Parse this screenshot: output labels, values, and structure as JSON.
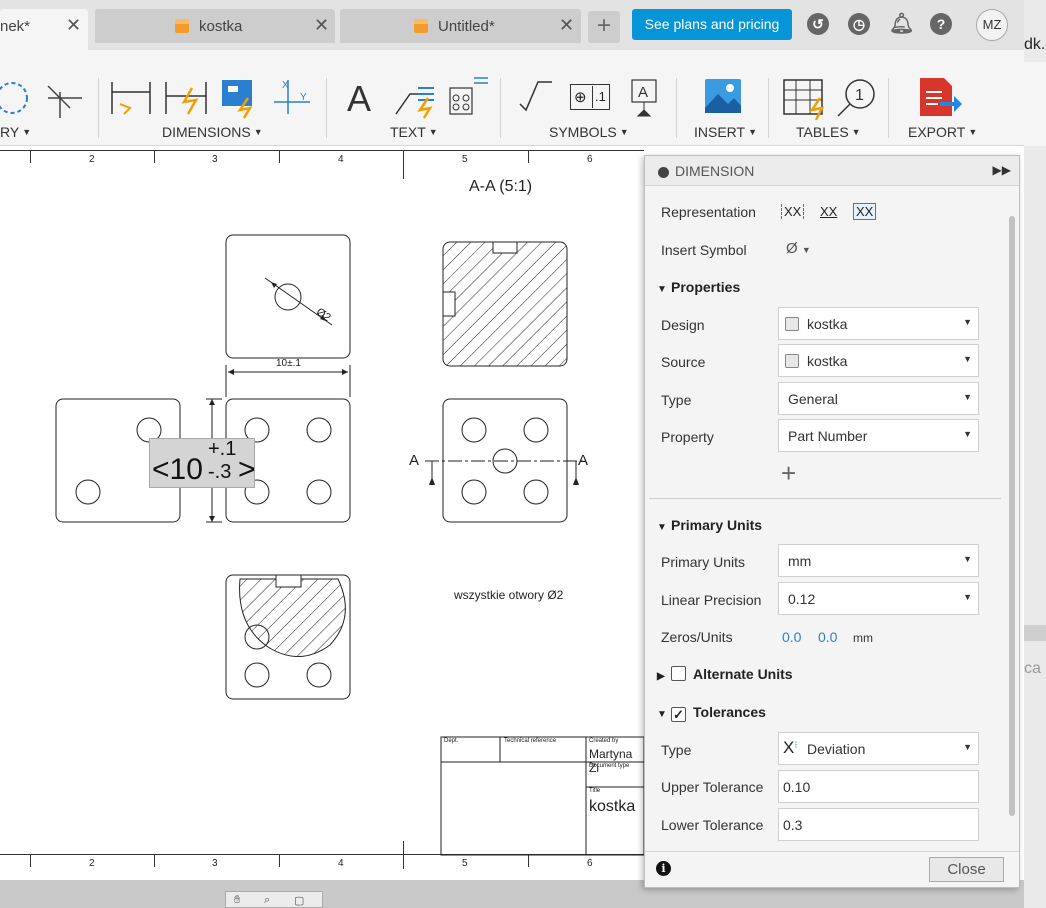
{
  "tabs": [
    {
      "label": "nek*",
      "active": true
    },
    {
      "label": "kostka",
      "active": false
    },
    {
      "label": "Untitled*",
      "active": false
    }
  ],
  "header": {
    "plans_button": "See plans and pricing",
    "avatar_initials": "MZ"
  },
  "ribbon": {
    "groups": [
      "RY",
      "DIMENSIONS",
      "TEXT",
      "SYMBOLS",
      "INSERT",
      "TABLES",
      "EXPORT"
    ],
    "text_glyph": "A",
    "symbol_text": ".1",
    "balloon_num": "1"
  },
  "drawing": {
    "ruler_numbers": [
      "2",
      "3",
      "4",
      "5",
      "6"
    ],
    "section_title": "A-A (5:1)",
    "dim_diameter": "Ø2",
    "dim_width": "10±.1",
    "dim_edit_main": "<10",
    "dim_edit_upper": "+.1",
    "dim_edit_lower": "-.3",
    "dim_edit_close": ">",
    "section_marker": "A",
    "note": "wszystkie otwory Ø2",
    "title_block": {
      "dept_label": "Dept.",
      "techref_label": "Technical reference",
      "created_label": "Created by",
      "created_value": "Martyna Zi",
      "doctype_label": "Document type",
      "title_label": "Title",
      "title_value": "kostka"
    }
  },
  "panel": {
    "title": "DIMENSION",
    "representation_label": "Representation",
    "representation_options": [
      "XX",
      "XX",
      "XX"
    ],
    "insert_symbol_label": "Insert Symbol",
    "insert_symbol_value": "Ø",
    "properties_label": "Properties",
    "design_label": "Design",
    "design_value": "kostka",
    "source_label": "Source",
    "source_value": "kostka",
    "type_label": "Type",
    "type_value": "General",
    "property_label": "Property",
    "property_value": "Part Number",
    "primary_units_section": "Primary Units",
    "primary_units_label": "Primary Units",
    "primary_units_value": "mm",
    "linear_precision_label": "Linear Precision",
    "linear_precision_value": "0.12",
    "zeros_label": "Zeros/Units",
    "zeros_value1": "0.0",
    "zeros_value2": "0.0",
    "zeros_unit": "mm",
    "alternate_units_label": "Alternate Units",
    "tolerances_label": "Tolerances",
    "tol_type_label": "Type",
    "tol_type_value": "Deviation",
    "upper_tol_label": "Upper Tolerance",
    "upper_tol_value": "0.10",
    "lower_tol_label": "Lower Tolerance",
    "lower_tol_value": "0.3",
    "close_label": "Close"
  },
  "right_edge": {
    "top_text": "dk.",
    "mid_text": "ca"
  }
}
